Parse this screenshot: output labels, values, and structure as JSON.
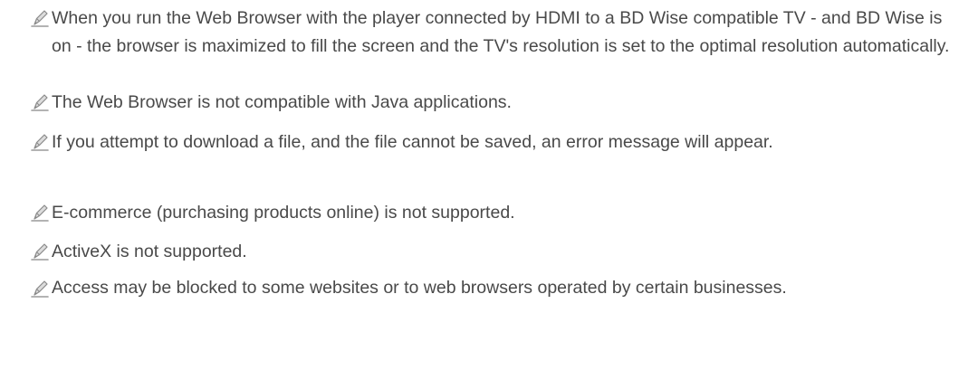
{
  "notes": [
    {
      "icon": "pencil-note-icon",
      "text": "When you run the Web Browser with the player connected by HDMI to a BD Wise compatible TV - and BD Wise is on - the browser is maximized to fill the screen and the TV's resolution is set to the optimal resolution automatically."
    },
    {
      "icon": "pencil-note-icon",
      "text": "The Web Browser is not compatible with Java applications."
    },
    {
      "icon": "pencil-note-icon",
      "text": "If you attempt to download a file, and the file cannot be saved, an error message will appear."
    },
    {
      "icon": "pencil-note-icon",
      "text": "E-commerce (purchasing products online) is not supported."
    },
    {
      "icon": "pencil-note-icon",
      "text": "ActiveX is not supported."
    },
    {
      "icon": "pencil-note-icon",
      "text": "Access may be blocked to some websites or to web browsers operated by certain businesses."
    }
  ],
  "colors": {
    "text": "#494949",
    "icon_primary": "#8a8a8a",
    "icon_secondary": "#d6d6d6"
  }
}
